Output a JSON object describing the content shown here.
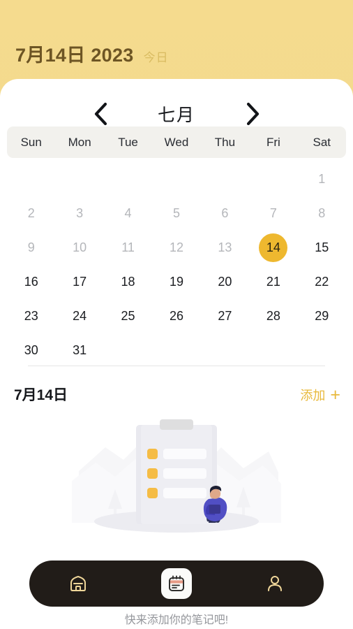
{
  "header": {
    "date_title": "7月14日 2023",
    "today_badge": "今日",
    "bg_color": "#f3d98c",
    "text_color": "#6d5524"
  },
  "calendar": {
    "prev_icon": "chevron-left-icon",
    "next_icon": "chevron-right-icon",
    "month_label": "七月",
    "weekdays": [
      "Sun",
      "Mon",
      "Tue",
      "Wed",
      "Thu",
      "Fri",
      "Sat"
    ],
    "weekday_bar_color": "#f2f1ed",
    "leading_blanks": 6,
    "days": [
      {
        "n": "1",
        "state": "past"
      },
      {
        "n": "2",
        "state": "past"
      },
      {
        "n": "3",
        "state": "past"
      },
      {
        "n": "4",
        "state": "past"
      },
      {
        "n": "5",
        "state": "past"
      },
      {
        "n": "6",
        "state": "past"
      },
      {
        "n": "7",
        "state": "past"
      },
      {
        "n": "8",
        "state": "past"
      },
      {
        "n": "9",
        "state": "past"
      },
      {
        "n": "10",
        "state": "past"
      },
      {
        "n": "11",
        "state": "past"
      },
      {
        "n": "12",
        "state": "past"
      },
      {
        "n": "13",
        "state": "past"
      },
      {
        "n": "14",
        "state": "today"
      },
      {
        "n": "15",
        "state": "normal"
      },
      {
        "n": "16",
        "state": "normal"
      },
      {
        "n": "17",
        "state": "normal"
      },
      {
        "n": "18",
        "state": "normal"
      },
      {
        "n": "19",
        "state": "normal"
      },
      {
        "n": "20",
        "state": "normal"
      },
      {
        "n": "21",
        "state": "normal"
      },
      {
        "n": "22",
        "state": "normal"
      },
      {
        "n": "23",
        "state": "normal"
      },
      {
        "n": "24",
        "state": "normal"
      },
      {
        "n": "25",
        "state": "normal"
      },
      {
        "n": "26",
        "state": "normal"
      },
      {
        "n": "27",
        "state": "normal"
      },
      {
        "n": "28",
        "state": "normal"
      },
      {
        "n": "29",
        "state": "normal"
      },
      {
        "n": "30",
        "state": "normal"
      },
      {
        "n": "31",
        "state": "normal"
      }
    ],
    "selected_day": "14",
    "today_circle_color": "#eeb82f"
  },
  "notes_section": {
    "title": "7月14日",
    "add_label": "添加",
    "add_plus": "+",
    "accent_color": "#e8b93c",
    "empty_text": "快来添加你的笔记吧!",
    "illustration_name": "empty-notes-illustration"
  },
  "tabbar": {
    "bg_color": "#211c18",
    "icon_color": "#f0d79a",
    "items": [
      {
        "name": "home",
        "icon": "home-icon",
        "active": false
      },
      {
        "name": "notes",
        "icon": "notepad-icon",
        "active": true
      },
      {
        "name": "profile",
        "icon": "person-icon",
        "active": false
      }
    ]
  }
}
